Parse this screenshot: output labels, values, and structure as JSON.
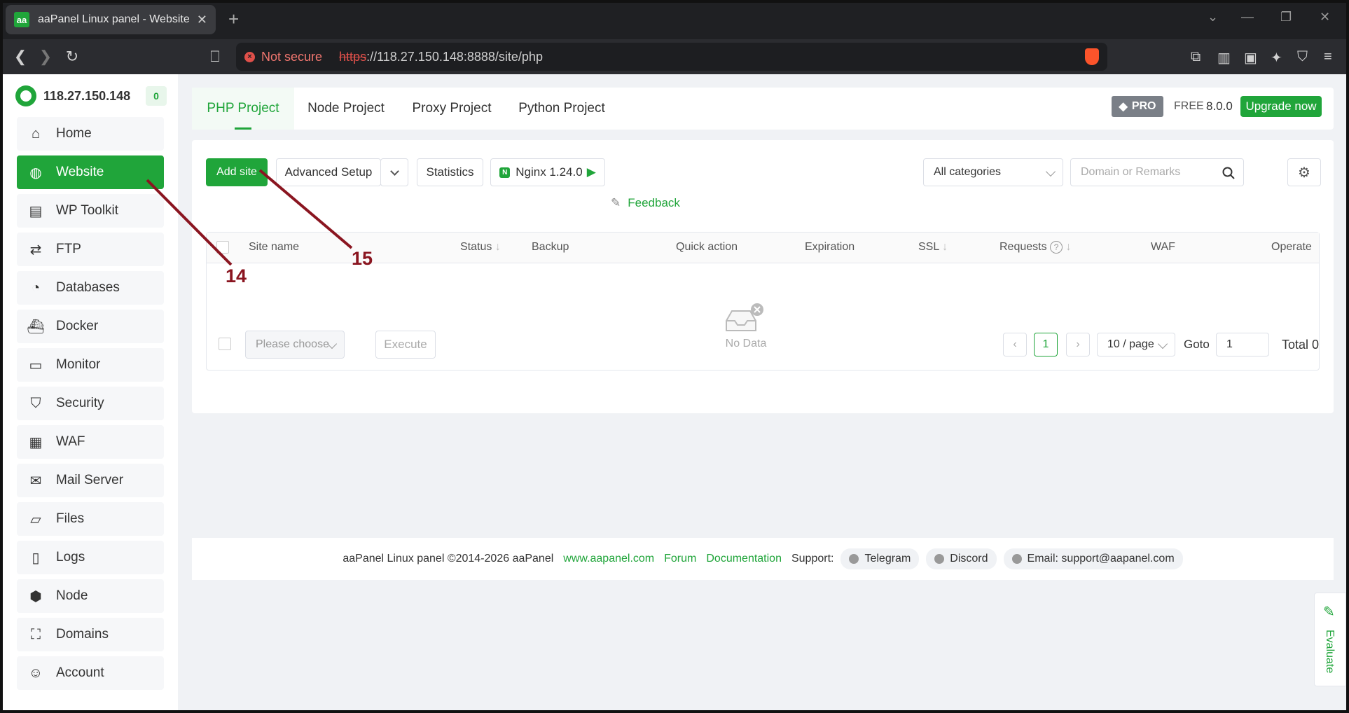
{
  "browser": {
    "tab_title": "aaPanel Linux panel - Website",
    "favicon_text": "aa",
    "not_secure": "Not secure",
    "url_scheme": "https",
    "url_rest": "://118.27.150.148:8888/site/php"
  },
  "sidebar": {
    "server_ip": "118.27.150.148",
    "badge": "0",
    "items": [
      {
        "label": "Home",
        "icon": "home-icon"
      },
      {
        "label": "Website",
        "icon": "globe-icon",
        "active": true
      },
      {
        "label": "WP Toolkit",
        "icon": "toolkit-icon"
      },
      {
        "label": "FTP",
        "icon": "transfer-icon"
      },
      {
        "label": "Databases",
        "icon": "database-icon"
      },
      {
        "label": "Docker",
        "icon": "docker-icon"
      },
      {
        "label": "Monitor",
        "icon": "monitor-icon"
      },
      {
        "label": "Security",
        "icon": "shield-icon"
      },
      {
        "label": "WAF",
        "icon": "firewall-icon"
      },
      {
        "label": "Mail Server",
        "icon": "mail-icon"
      },
      {
        "label": "Files",
        "icon": "folder-icon"
      },
      {
        "label": "Logs",
        "icon": "log-icon"
      },
      {
        "label": "Node",
        "icon": "node-icon"
      },
      {
        "label": "Domains",
        "icon": "domain-icon"
      },
      {
        "label": "Account",
        "icon": "user-icon"
      }
    ]
  },
  "project_tabs": [
    "PHP Project",
    "Node Project",
    "Proxy Project",
    "Python Project"
  ],
  "top_right": {
    "pro": "PRO",
    "free": "FREE",
    "version": "8.0.0",
    "upgrade": "Upgrade now"
  },
  "toolbar": {
    "add_site": "Add site",
    "advanced_setup": "Advanced Setup",
    "statistics": "Statistics",
    "nginx": "Nginx 1.24.0",
    "feedback": "Feedback",
    "category": "All categories",
    "search_placeholder": "Domain or Remarks"
  },
  "table": {
    "columns": [
      "Site name",
      "Status",
      "Backup",
      "Quick action",
      "Expiration",
      "SSL",
      "Requests",
      "WAF",
      "Operate"
    ],
    "empty_text": "No Data"
  },
  "bottom": {
    "batch_placeholder": "Please choose",
    "execute": "Execute",
    "current_page": "1",
    "page_size": "10 / page",
    "goto_label": "Goto",
    "goto_value": "1",
    "total": "Total 0"
  },
  "footer": {
    "copyright": "aaPanel Linux panel ©2014-2026 aaPanel",
    "site_link": "www.aapanel.com",
    "forum": "Forum",
    "documentation": "Documentation",
    "support_label": "Support:",
    "telegram": "Telegram",
    "discord": "Discord",
    "email": "Email: support@aapanel.com"
  },
  "evaluate": "Evaluate",
  "annotations": [
    "14",
    "15"
  ],
  "colors": {
    "accent": "#20a53a",
    "annotation": "#8a1520"
  }
}
